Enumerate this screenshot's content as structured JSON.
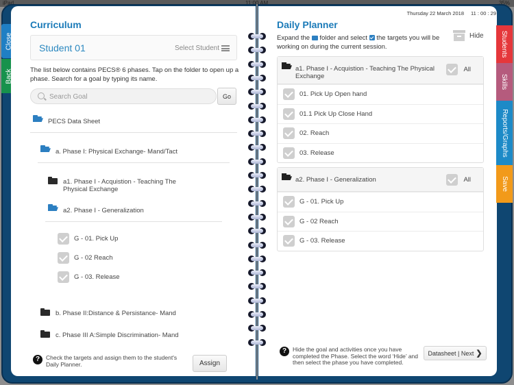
{
  "statusbar": {
    "carrier": "iPad",
    "time": "11:00 AM",
    "battery": "35%"
  },
  "tabs_left": {
    "close": "Close",
    "back": "Back"
  },
  "tabs_right": {
    "students": "Students",
    "skills": "Skills",
    "reports": "Reports/Graphs",
    "save": "Save"
  },
  "curriculum": {
    "title": "Curriculum",
    "student_name": "Student 01",
    "select_student": "Select Student",
    "intro": "The list below contains PECS® 6 phases. Tap on the folder to open up a phase. Search for a goal by typing its name.",
    "search_placeholder": "Search Goal",
    "search_value": "",
    "go_label": "Go",
    "tree": {
      "root": "PECS Data Sheet",
      "phase_a": "a. Phase I: Physical Exchange- Mand/Tact",
      "a1": "a1. Phase I - Acquistion - Teaching The Physical Exchange",
      "a2": "a2. Phase I - Generalization",
      "goals": [
        "G - 01. Pick Up",
        "G - 02 Reach",
        "G - 03. Release"
      ],
      "phase_b": "b. Phase II:Distance & Persistance- Mand",
      "phase_c": "c. Phase III A:Simple Discrimination- Mand"
    },
    "help_text": "Check the targets and assign them to the student's Daily Planner.",
    "assign_label": "Assign"
  },
  "planner": {
    "date": "Thursday 22 March 2018",
    "time": "11 : 00 : 29",
    "title": "Daily Planner",
    "intro_1": "Expand the",
    "intro_2": "folder and select",
    "intro_3": "the targets you will be working on during the current session.",
    "hide_label": "Hide",
    "all_label": "All",
    "phases": [
      {
        "title": "a1. Phase I - Acquistion - Teaching The Physical Exchange",
        "goals": [
          "01. Pick Up Open hand",
          "01.1 Pick Up Close Hand",
          "02. Reach",
          "03. Release"
        ]
      },
      {
        "title": "a2. Phase I - Generalization",
        "goals": [
          "G - 01. Pick Up",
          "G - 02 Reach",
          "G - 03. Release"
        ]
      }
    ],
    "help_text": "Hide the goal and activities once you have completed the Phase. Select the word ‘Hide’ and then select the phase you have completed.",
    "next_label": "Datasheet | Next"
  }
}
